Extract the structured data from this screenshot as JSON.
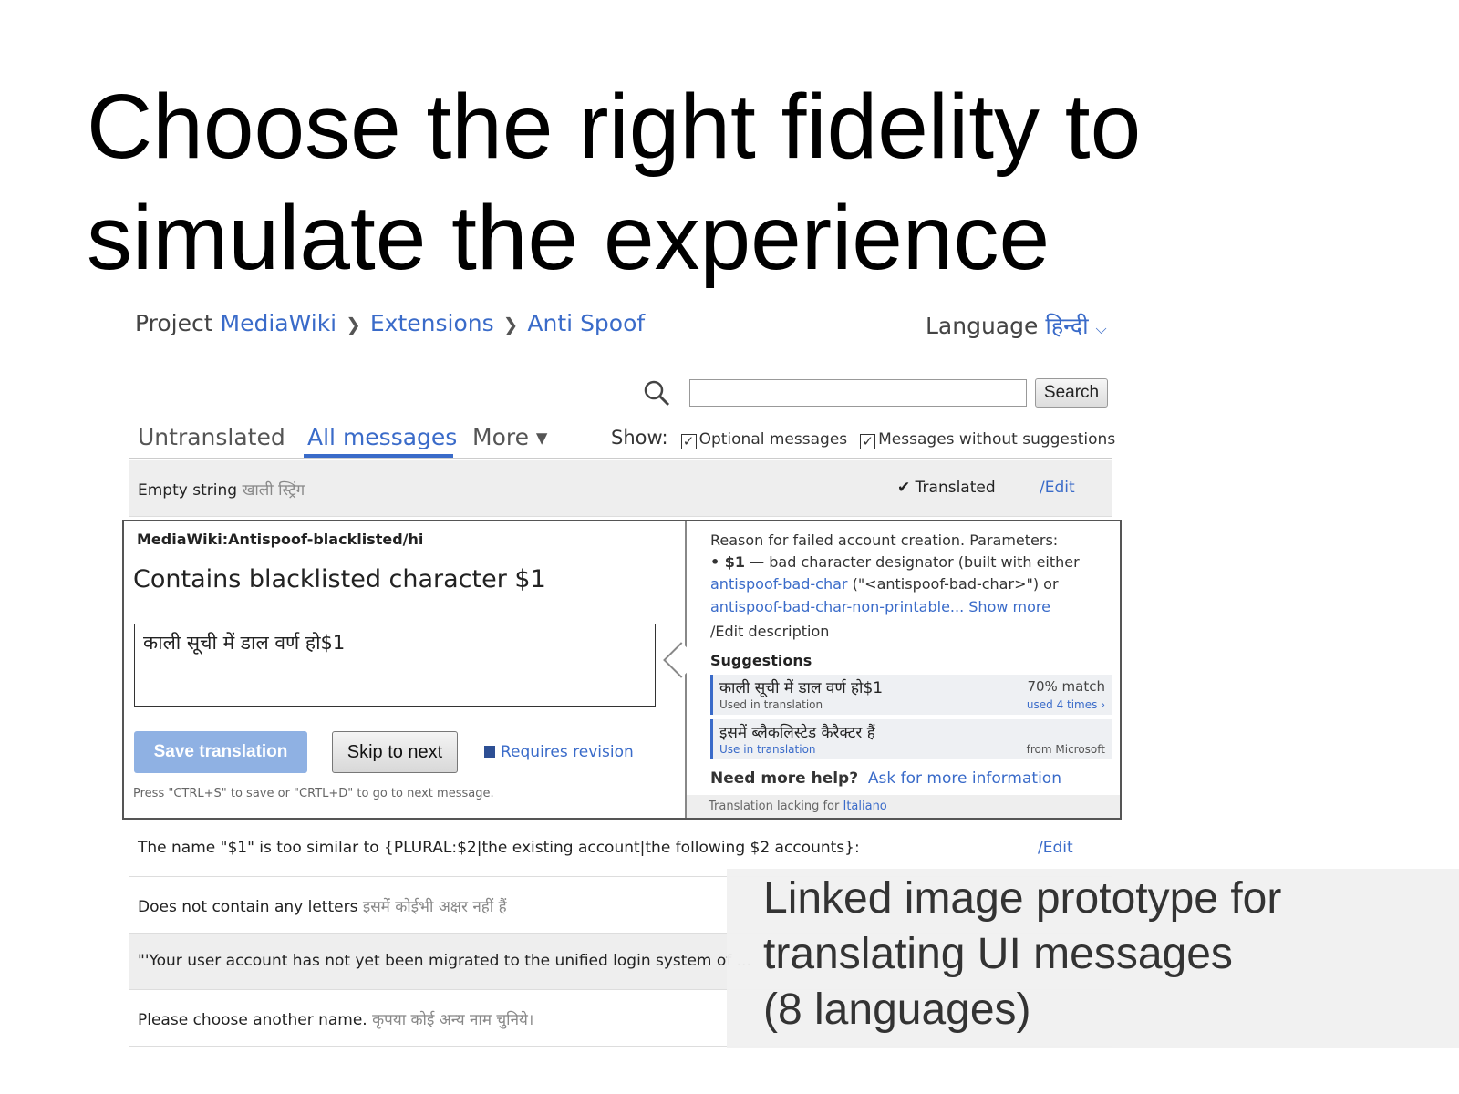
{
  "slide": {
    "title_line1": "Choose the right fidelity to",
    "title_line2": "simulate the experience",
    "caption_line1": "Linked image prototype for",
    "caption_line2": "translating UI messages",
    "caption_line3": "(8 languages)"
  },
  "breadcrumb": {
    "label": "Project",
    "items": [
      "MediaWiki",
      "Extensions",
      "Anti Spoof"
    ],
    "separator": "❯"
  },
  "language": {
    "label": "Language",
    "value": "हिन्दी"
  },
  "search": {
    "value": "",
    "button": "Search"
  },
  "tabs": [
    {
      "label": "Untranslated"
    },
    {
      "label": "All messages",
      "active": true
    },
    {
      "label": "More ▾"
    }
  ],
  "show": {
    "label": "Show:",
    "options": [
      {
        "label": "Optional messages",
        "checked": true
      },
      {
        "label": "Messages without suggestions",
        "checked": true
      }
    ]
  },
  "rows_before": [
    {
      "source": "Empty string",
      "translation": "खाली स्ट्रिंग",
      "status": "Translated",
      "edit": "Edit"
    }
  ],
  "editor": {
    "key": "MediaWiki:Antispoof-blacklisted/hi",
    "source": "Contains blacklisted character $1",
    "translation": "काली सूची में डाल वर्ण हो$1",
    "save": "Save translation",
    "skip": "Skip to next",
    "revision": "Requires revision",
    "hint": "Press \"CTRL+S\" to save or \"CRTL+D\" to go to next message.",
    "description_line1": "Reason for failed account creation. Parameters:",
    "param": "• $1",
    "param_desc": "— bad character designator (built with either",
    "link1": "antispoof-bad-char",
    "link1_after": "(\"<antispoof-bad-char>\") or",
    "link2": "antispoof-bad-char-non-printable...",
    "show_more": "Show more",
    "edit_description": "Edit description",
    "suggestions_title": "Suggestions",
    "suggestions": [
      {
        "text": "काली सूची में डाल वर्ण हो$1",
        "action": "Used in translation",
        "match": "70% match",
        "usage": "used 4 times ›"
      },
      {
        "text": "इसमें ब्लैकलिस्टेड कैरैक्टर हैं",
        "action": "Use in translation",
        "match": "",
        "usage": "from Microsoft"
      }
    ],
    "help_label": "Need more help?",
    "help_link": "Ask for more information",
    "lacking": "Translation lacking for",
    "lacking_lang": "Italiano"
  },
  "rows_after": [
    {
      "source": "The name \"$1\" is too similar to {PLURAL:$2|the existing account|the following $2 accounts}:",
      "translation": "",
      "edit": "Edit"
    },
    {
      "source": "Does not contain any letters",
      "translation": "इसमें कोईभी अक्षर नहीं हैं"
    },
    {
      "source": "\"'Your user account has not yet been migrated to the unified login system of ...",
      "translation": ""
    },
    {
      "source": "Please choose another name.",
      "translation": "कृपया कोई अन्य नाम चुनिये।"
    }
  ],
  "colors": {
    "link": "#3a6bc9",
    "save_button": "#8fb1e3",
    "row_alt": "#eeeeee"
  }
}
